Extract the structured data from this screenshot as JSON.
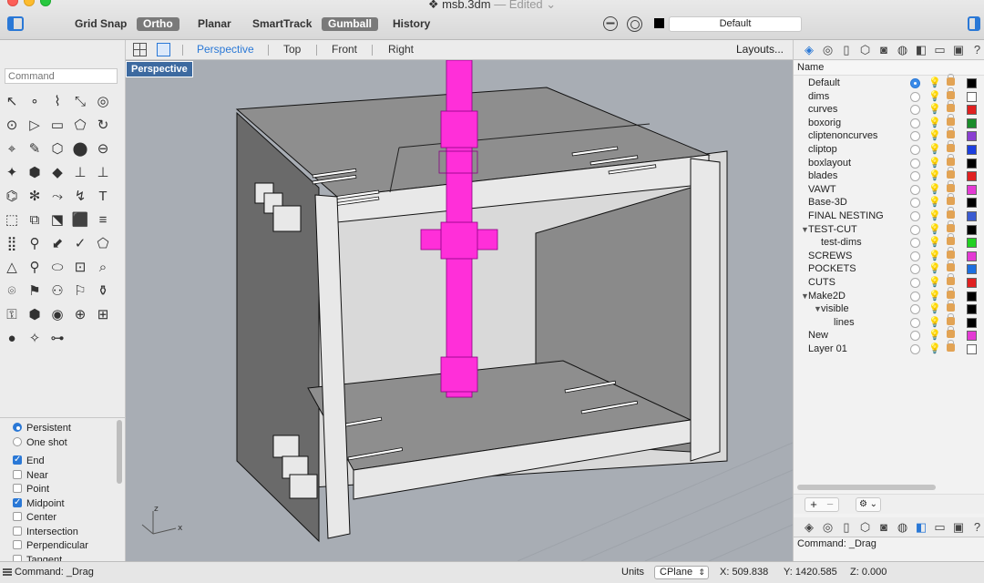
{
  "window": {
    "title": "msb.3dm",
    "edited": "— Edited ⌄"
  },
  "toolbar": {
    "modes": [
      {
        "label": "Grid Snap",
        "on": false
      },
      {
        "label": "Ortho",
        "on": true
      },
      {
        "label": "Planar",
        "on": false
      },
      {
        "label": "SmartTrack",
        "on": false
      },
      {
        "label": "Gumball",
        "on": true
      },
      {
        "label": "History",
        "on": false
      }
    ],
    "current_layer": "Default",
    "current_layer_color": "#000000"
  },
  "command": {
    "placeholder": "Command"
  },
  "views": {
    "tabs": [
      "Perspective",
      "Top",
      "Front",
      "Right"
    ],
    "active": "Perspective",
    "layouts_label": "Layouts..."
  },
  "viewport": {
    "label": "Perspective",
    "axis_x": "x",
    "axis_z": "z"
  },
  "tools": [
    "↖",
    "∘",
    "⌇",
    "⤡",
    "◎",
    "⊙",
    "▷",
    "▭",
    "⬠",
    "↻",
    "⌖",
    "✎",
    "⬡",
    "⬤",
    "⊖",
    "✦",
    "⬢",
    "◆",
    "⊥",
    "⊥",
    "⌬",
    "✻",
    "⤳",
    "↯",
    "T",
    "⬚",
    "⧉",
    "⬔",
    "⬛",
    "≡",
    "⣿",
    "⚲",
    "⬋",
    "✓",
    "⬠",
    "△",
    "⚲",
    "⬭",
    "⊡",
    "⌕",
    "⌾",
    "⚑",
    "⚇",
    "⚐",
    "⚱",
    "⚿",
    "⬢",
    "◉",
    "⊕",
    "⊞",
    "●",
    "✧",
    "⊶"
  ],
  "osnap": {
    "mode_options": [
      {
        "label": "Persistent",
        "checked": true
      },
      {
        "label": "One shot",
        "checked": false
      }
    ],
    "snaps": [
      {
        "label": "End",
        "checked": true
      },
      {
        "label": "Near",
        "checked": false
      },
      {
        "label": "Point",
        "checked": false
      },
      {
        "label": "Midpoint",
        "checked": true
      },
      {
        "label": "Center",
        "checked": false
      },
      {
        "label": "Intersection",
        "checked": false
      },
      {
        "label": "Perpendicular",
        "checked": false
      },
      {
        "label": "Tangent",
        "checked": false
      }
    ]
  },
  "layers": {
    "header": "Name",
    "items": [
      {
        "name": "Default",
        "indent": 0,
        "current": true,
        "bulb": "on",
        "color": "#000000"
      },
      {
        "name": "dims",
        "indent": 0,
        "current": false,
        "bulb": "off",
        "color": "#ffffff"
      },
      {
        "name": "curves",
        "indent": 0,
        "current": false,
        "bulb": "off",
        "color": "#e02020"
      },
      {
        "name": "boxorig",
        "indent": 0,
        "current": false,
        "bulb": "off",
        "color": "#1a8c2a"
      },
      {
        "name": "cliptenoncurves",
        "indent": 0,
        "current": false,
        "bulb": "off",
        "color": "#8a3fd1"
      },
      {
        "name": "cliptop",
        "indent": 0,
        "current": false,
        "bulb": "off",
        "color": "#1c3fe0"
      },
      {
        "name": "boxlayout",
        "indent": 0,
        "current": false,
        "bulb": "off",
        "color": "#000000"
      },
      {
        "name": "blades",
        "indent": 0,
        "current": false,
        "bulb": "off",
        "color": "#e02020"
      },
      {
        "name": "VAWT",
        "indent": 0,
        "current": false,
        "bulb": "on",
        "color": "#e43ad4"
      },
      {
        "name": "Base-3D",
        "indent": 0,
        "current": false,
        "bulb": "on",
        "color": "#000000"
      },
      {
        "name": "FINAL NESTING",
        "indent": 0,
        "current": false,
        "bulb": "off",
        "color": "#3a5bd1"
      },
      {
        "name": "TEST-CUT",
        "indent": 0,
        "expand": "▼",
        "current": false,
        "bulb": "off",
        "color": "#000000"
      },
      {
        "name": "test-dims",
        "indent": 1,
        "current": false,
        "bulb": "off",
        "color": "#22d122"
      },
      {
        "name": "SCREWS",
        "indent": 0,
        "current": false,
        "bulb": "off",
        "color": "#e43ad4"
      },
      {
        "name": "POCKETS",
        "indent": 0,
        "current": false,
        "bulb": "off",
        "color": "#1c6fe0"
      },
      {
        "name": "CUTS",
        "indent": 0,
        "current": false,
        "bulb": "off",
        "color": "#e02020"
      },
      {
        "name": "Make2D",
        "indent": 0,
        "expand": "▼",
        "current": false,
        "bulb": "off",
        "color": "#000000"
      },
      {
        "name": "visible",
        "indent": 1,
        "expand": "▼",
        "current": false,
        "bulb": "off",
        "color": "#000000"
      },
      {
        "name": "lines",
        "indent": 2,
        "current": false,
        "bulb": "off",
        "color": "#000000"
      },
      {
        "name": "New",
        "indent": 0,
        "current": false,
        "bulb": "off",
        "color": "#e43ad4"
      },
      {
        "name": "Layer 01",
        "indent": 0,
        "current": false,
        "bulb": "off",
        "color": "#ffffff"
      }
    ],
    "add_label": "+",
    "remove_label": "−",
    "gear_label": "⚙ ⌄"
  },
  "command_history": "Command: _Drag",
  "status": {
    "command": "Command: _Drag",
    "units": "Units",
    "cplane": "CPlane",
    "x": "X: 509.838",
    "y": "Y: 1420.585",
    "z": "Z: 0.000"
  },
  "panel_icons": [
    "layers-icon",
    "materials-icon",
    "document-icon",
    "object-icon",
    "camera-icon",
    "display-icon",
    "help-icon",
    "viewport-icon",
    "monitor-icon",
    "question-icon"
  ]
}
